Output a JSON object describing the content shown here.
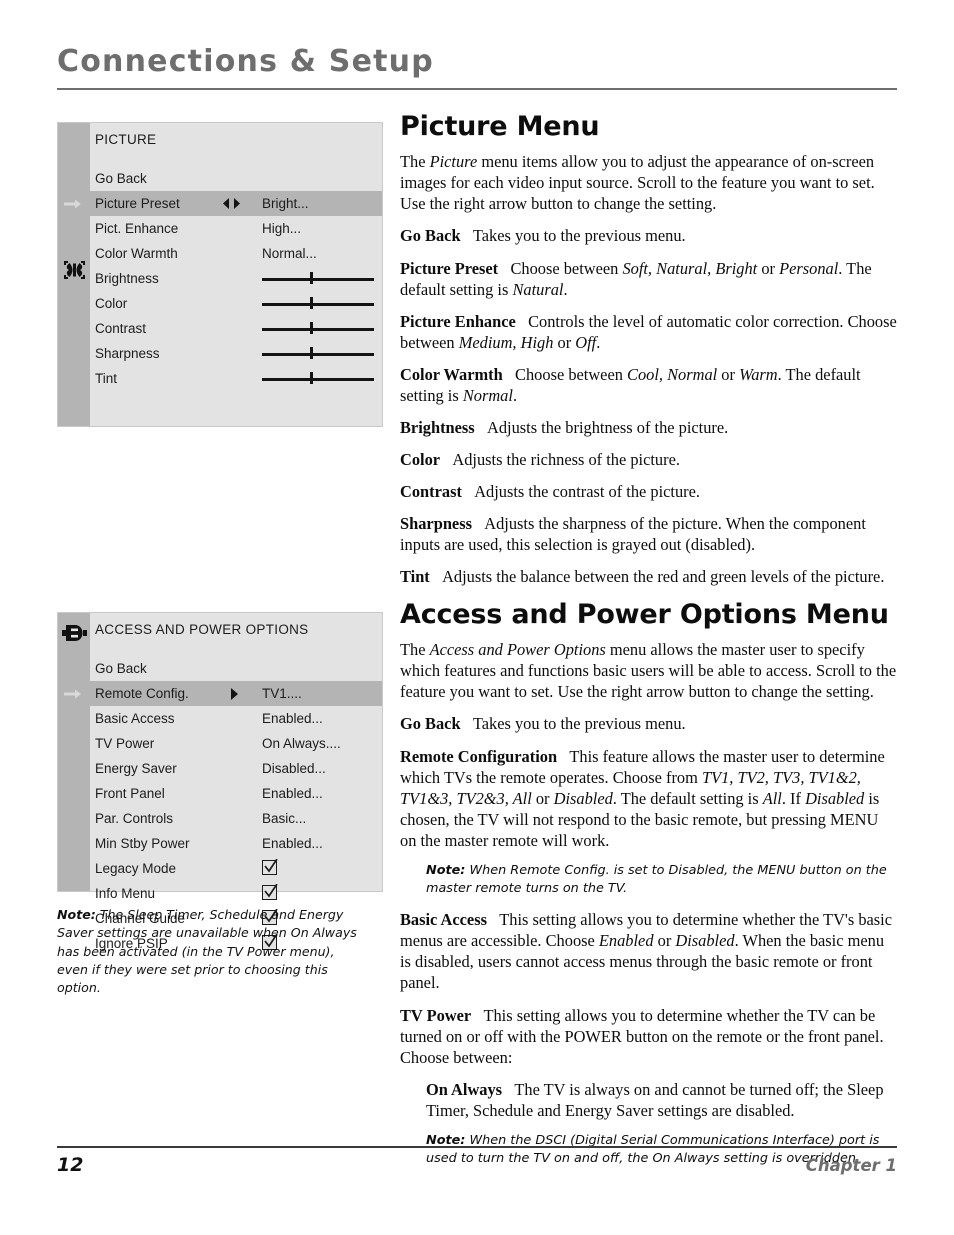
{
  "header": {
    "title": "Connections & Setup"
  },
  "picture_menu_osd": {
    "icon": "butterfly-picture-icon",
    "title": "PICTURE",
    "rows": [
      {
        "label": "Go Back",
        "value": "",
        "type": "plain"
      },
      {
        "label": "Picture Preset",
        "value": "Bright...",
        "type": "lr-select",
        "highlighted": true
      },
      {
        "label": "Pict. Enhance",
        "value": "High...",
        "type": "plain"
      },
      {
        "label": "Color Warmth",
        "value": "Normal...",
        "type": "plain"
      },
      {
        "label": "Brightness",
        "value": "",
        "type": "slider"
      },
      {
        "label": "Color",
        "value": "",
        "type": "slider"
      },
      {
        "label": "Contrast",
        "value": "",
        "type": "slider"
      },
      {
        "label": "Sharpness",
        "value": "",
        "type": "slider"
      },
      {
        "label": "Tint",
        "value": "",
        "type": "slider"
      }
    ]
  },
  "access_menu_osd": {
    "icon": "plug-connector-icon",
    "title": "ACCESS AND POWER OPTIONS",
    "rows": [
      {
        "label": "Go Back",
        "value": "",
        "type": "plain"
      },
      {
        "label": "Remote Config.",
        "value": "TV1....",
        "type": "submenu",
        "highlighted": true
      },
      {
        "label": "Basic Access",
        "value": "Enabled...",
        "type": "plain"
      },
      {
        "label": "TV Power",
        "value": "On Always....",
        "type": "plain"
      },
      {
        "label": "Energy Saver",
        "value": "Disabled...",
        "type": "plain"
      },
      {
        "label": "Front Panel",
        "value": "Enabled...",
        "type": "plain"
      },
      {
        "label": "Par. Controls",
        "value": "Basic...",
        "type": "plain"
      },
      {
        "label": "Min Stby Power",
        "value": "Enabled...",
        "type": "plain"
      },
      {
        "label": "Legacy Mode",
        "value": "",
        "type": "checkbox",
        "checked": true
      },
      {
        "label": "Info Menu",
        "value": "",
        "type": "checkbox",
        "checked": true
      },
      {
        "label": "Channel Guide",
        "value": "",
        "type": "checkbox",
        "checked": true
      },
      {
        "label": "Ignore PSIP",
        "value": "",
        "type": "checkbox",
        "checked": true
      }
    ]
  },
  "side_note": {
    "label": "Note:",
    "text": " The Sleep Timer, Schedule and Energy Saver settings are unavailable when On Always has been activated (in the TV Power menu), even if they were set prior to choosing this option."
  },
  "picture_section": {
    "title": "Picture Menu",
    "intro_1": "The ",
    "intro_em": "Picture",
    "intro_2": " menu items allow you to adjust the appearance of on-screen images for each video input source. Scroll to the feature you want to set. Use the right arrow button to change the setting.",
    "items": [
      {
        "term": "Go Back",
        "body": "Takes you to the previous menu."
      },
      {
        "term": "Picture Preset",
        "body_1": "Choose between ",
        "em_1": "Soft, Natural, Bright",
        "body_2": " or ",
        "em_2": "Personal",
        "body_3": ". The default setting is ",
        "em_3": "Natural",
        "body_4": "."
      },
      {
        "term": "Picture Enhance",
        "body_1": "Controls the level of automatic color correction. Choose between ",
        "em_1": "Medium, High",
        "body_2": " or ",
        "em_2": "Off",
        "body_3": "."
      },
      {
        "term": "Color Warmth",
        "body_1": "Choose between ",
        "em_1": "Cool, Normal",
        "body_2": " or ",
        "em_2": "Warm",
        "body_3": ". The default setting is ",
        "em_3": "Normal",
        "body_4": "."
      },
      {
        "term": "Brightness",
        "body": "Adjusts the brightness of the picture."
      },
      {
        "term": "Color",
        "body": "Adjusts the richness of the picture."
      },
      {
        "term": "Contrast",
        "body": "Adjusts the contrast of the picture."
      },
      {
        "term": "Sharpness",
        "body": "Adjusts the sharpness of the picture. When the component inputs are used, this selection is grayed out (disabled)."
      },
      {
        "term": "Tint",
        "body": "Adjusts the balance between the red and green levels of the picture."
      }
    ]
  },
  "access_section": {
    "title": "Access and Power Options Menu",
    "intro_1": "The ",
    "intro_em": "Access and Power Options",
    "intro_2": " menu allows the master user to specify which features and functions basic users will be able to access. Scroll to the feature you want to set. Use the right arrow button to change the setting.",
    "go_back_term": "Go Back",
    "go_back_body": "Takes you to the previous menu.",
    "remote_config": {
      "term": "Remote Configuration",
      "body_1": "This feature allows the master user to determine which TVs the remote operates. Choose from ",
      "em_1": "TV1, TV2, TV3, TV1&2, TV1&3, TV2&3, All",
      "body_2": " or ",
      "em_2": "Disabled",
      "body_3": ". The default setting is ",
      "em_3": "All",
      "body_4": ". If ",
      "em_4": "Disabled",
      "body_5": " is chosen, the TV will not respond to the basic remote, but pressing MENU on the master remote will work."
    },
    "remote_note": {
      "label": "Note:",
      "text": " When Remote Config. is set to Disabled, the MENU button on the master remote turns on the TV."
    },
    "basic_access": {
      "term": "Basic Access",
      "body_1": "This setting allows you to determine whether the TV's basic menus are accessible. Choose ",
      "em_1": "Enabled",
      "body_2": " or ",
      "em_2": "Disabled",
      "body_3": ". When the basic menu is disabled, users cannot access menus through the basic remote or front panel."
    },
    "tv_power": {
      "term": "TV Power",
      "body": "This setting allows you to determine whether the TV can be turned on or off with the POWER button on the remote or the front panel. Choose between:"
    },
    "on_always": {
      "term": "On Always",
      "body": "The TV is always on and cannot be turned off; the Sleep Timer, Schedule and Energy Saver settings are disabled."
    },
    "dsci_note": {
      "label": "Note:",
      "text": " When the DSCI (Digital Serial Communications Interface) port is used to turn the TV on and off, the On Always setting is overridden."
    }
  },
  "footer": {
    "page_number": "12",
    "chapter": "Chapter 1"
  },
  "colors": {
    "header_gray": "#6e6e6e",
    "osd_panel": "#e3e3e3",
    "osd_rail": "#b4b4b4",
    "osd_highlight": "#b4b4b4",
    "text_black": "#0d0d0d"
  }
}
